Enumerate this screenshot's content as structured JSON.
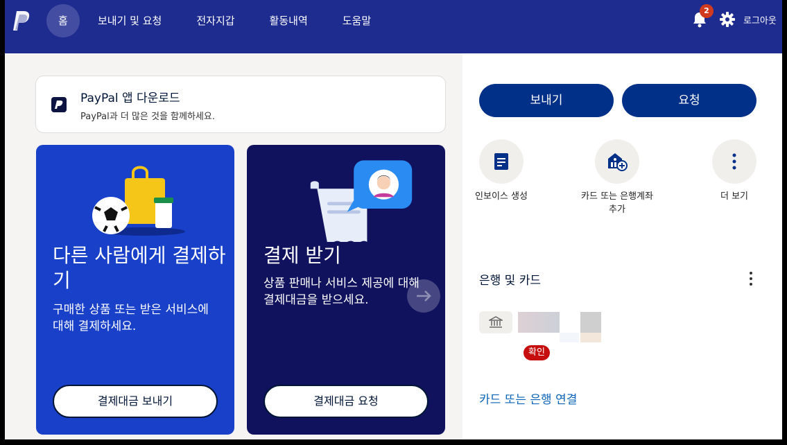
{
  "header": {
    "logo": "paypal-logo",
    "nav": [
      "홈",
      "보내기 및 요청",
      "전자지갑",
      "활동내역",
      "도움말"
    ],
    "notification_count": "2",
    "logout": "로그아웃",
    "color": "#1f2c8f"
  },
  "app_banner": {
    "title": "PayPal 앱 다운로드",
    "subtitle": "PayPal과 더 많은 것을 함께하세요."
  },
  "promos": [
    {
      "title": "다른 사람에게 결제하기",
      "description": "구매한 상품 또는 받은 서비스에 대해 결제하세요.",
      "button": "결제대금 보내기",
      "color": "#1940c8"
    },
    {
      "title": "결제 받기",
      "description": "상품 판매나 서비스 제공에 대해 결제대금을 받으세요.",
      "button": "결제대금 요청",
      "color": "#10125e"
    }
  ],
  "actions": {
    "send": "보내기",
    "request": "요청"
  },
  "quick_actions": [
    {
      "label": "인보이스 생성",
      "icon": "invoice-icon"
    },
    {
      "label": "카드 또는 은행계좌 추가",
      "icon": "add-bank-icon"
    },
    {
      "label": "더 보기",
      "icon": "more-vertical-icon"
    }
  ],
  "banks_cards": {
    "title": "은행 및 카드",
    "confirm_badge": "확인",
    "link": "카드 또는 은행 연결"
  }
}
